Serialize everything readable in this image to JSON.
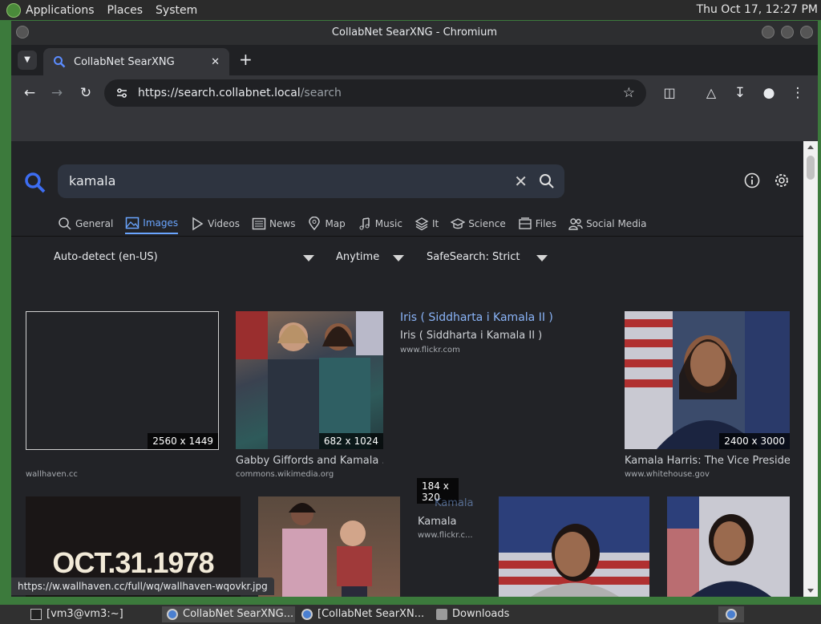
{
  "top_panel": {
    "menus": [
      "Applications",
      "Places",
      "System"
    ],
    "clock": "Thu Oct 17, 12:27 PM"
  },
  "window": {
    "title": "CollabNet SearXNG - Chromium",
    "tab_title": "CollabNet SearXNG",
    "url_host": "https://search.collabnet.local",
    "url_path": "/search"
  },
  "search": {
    "query": "kamala",
    "categories": [
      "General",
      "Images",
      "Videos",
      "News",
      "Map",
      "Music",
      "It",
      "Science",
      "Files",
      "Social Media"
    ],
    "active_category": "Images",
    "language": "Auto-detect (en-US)",
    "time_range": "Anytime",
    "safesearch": "SafeSearch: Strict"
  },
  "results": [
    {
      "size": "2560 x 1449",
      "title": "",
      "source": "wallhaven.cc"
    },
    {
      "size": "682 x 1024",
      "title": "Gabby Giffords and Kamala ...",
      "source": "commons.wikimedia.org"
    },
    {
      "size": "",
      "title": "Iris ( Siddharta i Kamala II )",
      "alt": "Iris ( Siddharta i Kamala II )",
      "source": "www.flickr.com"
    },
    {
      "size": "2400 x 3000",
      "title": "Kamala Harris: The Vice President",
      "source": "www.whitehouse.gov"
    },
    {
      "size": "",
      "title": "",
      "image_text": "OCT.31.1978",
      "source": ""
    },
    {
      "size": "",
      "title": "",
      "source": ""
    },
    {
      "size": "184 x 320",
      "title": "Kamala",
      "alt": "Kamala",
      "source": "www.flickr.c..."
    },
    {
      "size": "",
      "title": "",
      "source": ""
    },
    {
      "size": "",
      "title": "",
      "source": ""
    }
  ],
  "status_url": "https://w.wallhaven.cc/full/wq/wallhaven-wqovkr.jpg",
  "taskbar": {
    "items": [
      "[vm3@vm3:~]",
      "CollabNet SearXNG...",
      "[CollabNet SearXN...",
      "Downloads"
    ]
  },
  "colors": {
    "accent": "#6aa5ff",
    "page_bg": "#222327",
    "link": "#8ab4f8"
  }
}
